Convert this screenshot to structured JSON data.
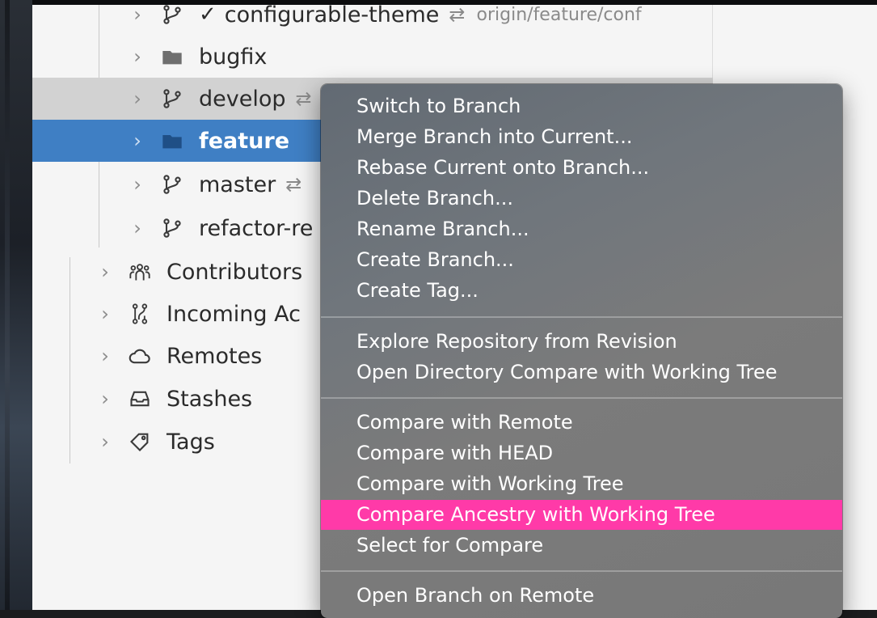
{
  "tree": {
    "branches": [
      {
        "label": "configurable-theme",
        "checked": true,
        "tracking": "origin/feature/conf",
        "type": "branch"
      },
      {
        "label": "bugfix",
        "type": "folder"
      },
      {
        "label": "develop",
        "type": "branch",
        "sync_glyph": "⇄"
      },
      {
        "label": "feature",
        "type": "folder"
      },
      {
        "label": "master",
        "type": "branch",
        "sync_glyph": "⇄"
      },
      {
        "label": "refactor-re",
        "type": "branch"
      }
    ],
    "sections": [
      {
        "label": "Contributors",
        "icon": "people-icon"
      },
      {
        "label": "Incoming Ac",
        "icon": "branch-compare-icon"
      },
      {
        "label": "Remotes",
        "icon": "cloud-icon"
      },
      {
        "label": "Stashes",
        "icon": "inbox-icon"
      },
      {
        "label": "Tags",
        "icon": "tag-icon"
      }
    ],
    "checkmark": "✓",
    "tracking_glyph": "⇄"
  },
  "menu": {
    "group1": [
      "Switch to Branch",
      "Merge Branch into Current...",
      "Rebase Current onto Branch...",
      "Delete Branch...",
      "Rename Branch...",
      "Create Branch...",
      "Create Tag..."
    ],
    "group2": [
      "Explore Repository from Revision",
      "Open Directory Compare with Working Tree"
    ],
    "group3": [
      "Compare with Remote",
      "Compare with HEAD",
      "Compare with Working Tree",
      "Compare Ancestry with Working Tree",
      "Select for Compare"
    ],
    "group4": [
      "Open Branch on Remote"
    ],
    "highlighted": "Compare Ancestry with Working Tree",
    "highlight_color": "#ff3aa8"
  },
  "colors": {
    "selection": "#3f7fc4",
    "hover": "#d2d2d2"
  }
}
